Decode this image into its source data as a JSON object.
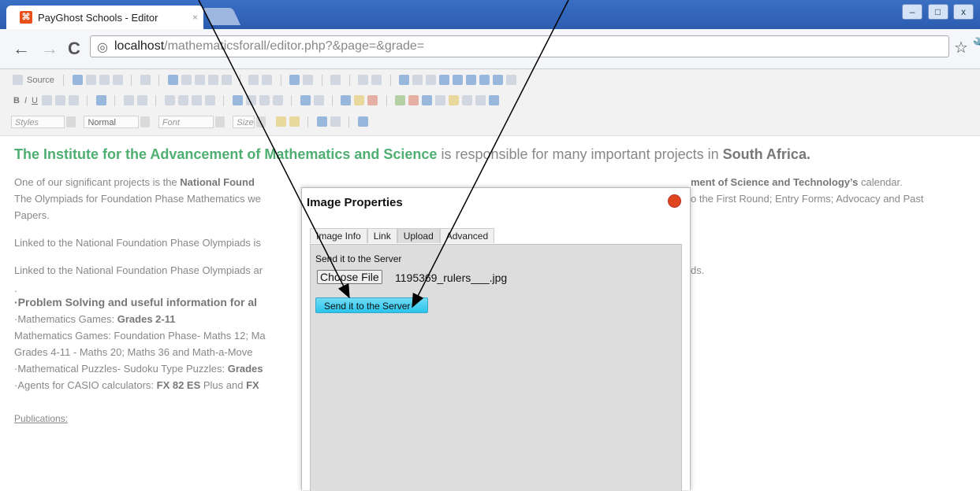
{
  "browser": {
    "tab_title": "PayGhost Schools - Editor",
    "tab_close": "×",
    "url_host": "localhost",
    "url_path": "/mathematicsforall/editor.php?&page=&grade=",
    "window_buttons": [
      "–",
      "□",
      "x"
    ]
  },
  "toolbar": {
    "source_label": "Source",
    "styles_label": "Styles",
    "format_value": "Normal",
    "font_label": "Font",
    "size_label": "Size"
  },
  "content": {
    "headline": {
      "part1": "The Institute for the Advancement of Mathematics and Science",
      "part2": " is responsible for many important projects in ",
      "part3": "South Africa."
    },
    "para1": {
      "a": "One of our significant projects is the ",
      "b": "National Found",
      "c": "ment of Science and Technology’s",
      "d": " calendar.",
      "line2_left": "The Olympiads for Foundation Phase Mathematics we",
      "line2_right": "o the First Round; Entry Forms; Advocacy and Past",
      "line3": "Papers."
    },
    "para2": "Linked to the National Foundation Phase Olympiads is",
    "para3_left": "Linked to the National Foundation Phase Olympiads ar",
    "para3_right": "ds.",
    "dot": ".",
    "problem_heading": "·Problem Solving and useful information for al",
    "games_line": "·Mathematics Games: ",
    "games_grades": "Grades 2-11",
    "games_detail": "Mathematics Games: Foundation Phase- Maths 12; Ma",
    "grades_line": "Grades 4-11 - Maths 20; Maths 36 and Math-a-Move",
    "puzzles_line": "·Mathematical Puzzles- Sudoku Type Puzzles: ",
    "puzzles_grades": "Grades",
    "agents_line": "·Agents for CASIO calculators: ",
    "agents_fx": "FX 82 ES",
    "agents_plus": " Plus and ",
    "agents_fx2": "FX",
    "publications": "Publications:"
  },
  "dialog": {
    "title": "Image Properties",
    "tabs": [
      "Image Info",
      "Link",
      "Upload",
      "Advanced"
    ],
    "active_tab": "Upload",
    "send_label": "Send it to the Server",
    "choose_file": "Choose File",
    "file_name": "1195369_rulers___.jpg",
    "send_button": "Send it to the Server"
  },
  "colors": {
    "accent_green": "#4fae71",
    "send_button": "#2bc4ec",
    "close_button": "#e0461e",
    "chrome_blue": "#2b5cb0"
  }
}
